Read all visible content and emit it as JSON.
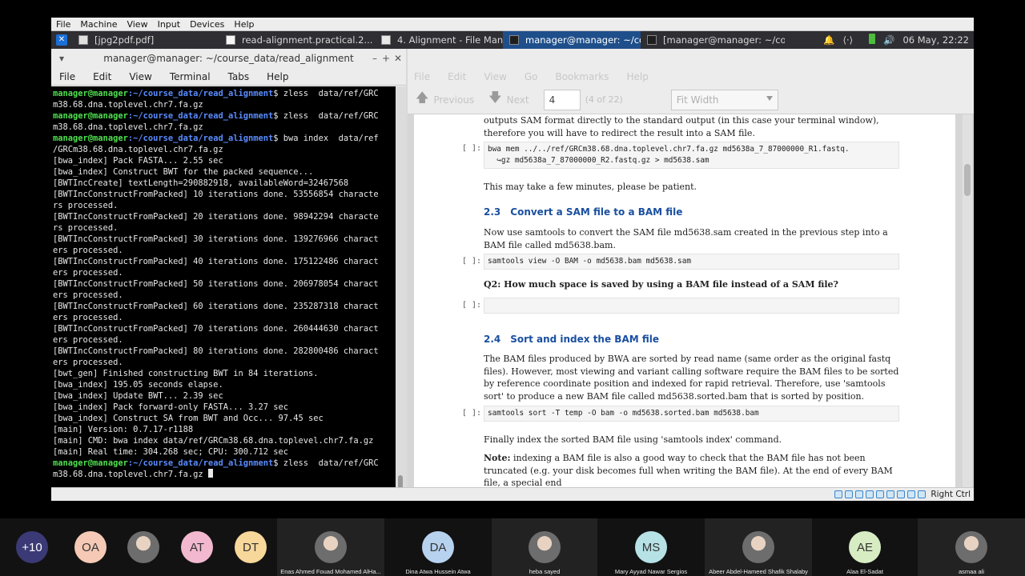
{
  "vbox_menu": [
    "File",
    "Machine",
    "View",
    "Input",
    "Devices",
    "Help"
  ],
  "panel": {
    "tasks": [
      {
        "label": "[jpg2pdf.pdf]",
        "active": false
      },
      {
        "label": "read-alignment.practical.2...",
        "active": false
      },
      {
        "label": "4. Alignment - File Manager",
        "active": false
      },
      {
        "label": "manager@manager: ~/cou...",
        "active": true
      },
      {
        "label": "[manager@manager: ~/co...",
        "active": false
      }
    ],
    "clock": "06 May, 22:22"
  },
  "terminal": {
    "title": "manager@manager: ~/course_data/read_alignment",
    "menu": [
      "File",
      "Edit",
      "View",
      "Terminal",
      "Tabs",
      "Help"
    ],
    "lines": [
      {
        "user": "manager@manager",
        "path": ":~/course_data/read_alignment",
        "text": "$ zless  data/ref/GRC"
      },
      {
        "text": "m38.68.dna.toplevel.chr7.fa.gz"
      },
      {
        "user": "manager@manager",
        "path": ":~/course_data/read_alignment",
        "text": "$ zless  data/ref/GRC"
      },
      {
        "text": "m38.68.dna.toplevel.chr7.fa.gz"
      },
      {
        "user": "manager@manager",
        "path": ":~/course_data/read_alignment",
        "text": "$ bwa index  data/ref"
      },
      {
        "text": "/GRCm38.68.dna.toplevel.chr7.fa.gz"
      },
      {
        "text": "[bwa_index] Pack FASTA... 2.55 sec"
      },
      {
        "text": "[bwa_index] Construct BWT for the packed sequence..."
      },
      {
        "text": "[BWTIncCreate] textLength=290882918, availableWord=32467568"
      },
      {
        "text": "[BWTIncConstructFromPacked] 10 iterations done. 53556854 characte"
      },
      {
        "text": "rs processed."
      },
      {
        "text": "[BWTIncConstructFromPacked] 20 iterations done. 98942294 characte"
      },
      {
        "text": "rs processed."
      },
      {
        "text": "[BWTIncConstructFromPacked] 30 iterations done. 139276966 charact"
      },
      {
        "text": "ers processed."
      },
      {
        "text": "[BWTIncConstructFromPacked] 40 iterations done. 175122486 charact"
      },
      {
        "text": "ers processed."
      },
      {
        "text": "[BWTIncConstructFromPacked] 50 iterations done. 206978054 charact"
      },
      {
        "text": "ers processed."
      },
      {
        "text": "[BWTIncConstructFromPacked] 60 iterations done. 235287318 charact"
      },
      {
        "text": "ers processed."
      },
      {
        "text": "[BWTIncConstructFromPacked] 70 iterations done. 260444630 charact"
      },
      {
        "text": "ers processed."
      },
      {
        "text": "[BWTIncConstructFromPacked] 80 iterations done. 282800486 charact"
      },
      {
        "text": "ers processed."
      },
      {
        "text": "[bwt_gen] Finished constructing BWT in 84 iterations."
      },
      {
        "text": "[bwa_index] 195.05 seconds elapse."
      },
      {
        "text": "[bwa_index] Update BWT... 2.39 sec"
      },
      {
        "text": "[bwa_index] Pack forward-only FASTA... 3.27 sec"
      },
      {
        "text": "[bwa_index] Construct SA from BWT and Occ... 97.45 sec"
      },
      {
        "text": "[main] Version: 0.7.17-r1188"
      },
      {
        "text": "[main] CMD: bwa index data/ref/GRCm38.68.dna.toplevel.chr7.fa.gz"
      },
      {
        "text": "[main] Real time: 304.268 sec; CPU: 300.712 sec"
      },
      {
        "user": "manager@manager",
        "path": ":~/course_data/read_alignment",
        "text": "$ zless  data/ref/GRC"
      },
      {
        "text": "m38.68.dna.toplevel.chr7.fa.gz ",
        "cursor": true
      }
    ]
  },
  "doc": {
    "menu": [
      "File",
      "Edit",
      "View",
      "Go",
      "Bookmarks",
      "Help"
    ],
    "toolbar": {
      "previous": "Previous",
      "next": "Next",
      "page": "4",
      "page_count": "(4 of 22)",
      "zoom": "Fit Width"
    },
    "intro": "outputs SAM format directly to the standard output (in this case your terminal window), therefore you will have to redirect the result into a SAM file.",
    "cell_label": "[ ]:",
    "code1": "bwa mem ../../ref/GRCm38.68.dna.toplevel.chr7.fa.gz md5638a_7_87000000_R1.fastq.\n  ↪gz md5638a_7_87000000_R2.fastq.gz > md5638.sam",
    "wait_text": "This may take a few minutes, please be patient.",
    "h23_num": "2.3",
    "h23_title": "Convert a SAM file to a BAM file",
    "p23": "Now use samtools to convert the SAM file md5638.sam created in the previous step into a BAM file called md5638.bam.",
    "code2": "samtools view -O BAM -o md5638.bam md5638.sam",
    "q2": "Q2:  How much space is saved by using a BAM file instead of a SAM file?",
    "h24_num": "2.4",
    "h24_title": "Sort and index the BAM file",
    "p24": "The BAM files produced by BWA are sorted by read name (same order as the original fastq files). However, most viewing and variant calling software require the BAM files to be sorted by reference coordinate position and indexed for rapid retrieval.  Therefore, use 'samtools sort' to produce a new BAM file called md5638.sorted.bam that is sorted by position.",
    "code3": "samtools sort -T temp -O bam -o md5638.sorted.bam md5638.bam",
    "p_index": "Finally index the sorted BAM file using 'samtools index' command.",
    "note_label": "Note:",
    "note_text": " indexing a BAM file is also a good way to check that the BAM file has not been truncated (e.g. your disk becomes full when writing the BAM file).  At the end of every BAM file, a special end"
  },
  "vbox_status": {
    "host_key": "Right Ctrl"
  },
  "participants": [
    {
      "initials": "+10",
      "name": "",
      "color": "#3b3a76"
    },
    {
      "initials": "OA",
      "name": "",
      "color": "#f5c9b6"
    },
    {
      "initials": "",
      "name": "",
      "color": "#555",
      "photo": true
    },
    {
      "initials": "AT",
      "name": "",
      "color": "#f2b8cf"
    },
    {
      "initials": "DT",
      "name": "",
      "color": "#f7d79a"
    },
    {
      "initials": "",
      "name": "Enas Ahmed Fouad Mohamed AlHa...",
      "photo": true
    },
    {
      "initials": "DA",
      "name": "Dina Atwa Hussein Atwa",
      "color": "#b7d2ef"
    },
    {
      "initials": "",
      "name": "heba sayed",
      "photo": true
    },
    {
      "initials": "MS",
      "name": "Mary Ayyad Nawar Sergios",
      "color": "#b6e2e6"
    },
    {
      "initials": "",
      "name": "Abeer Abdel-Hameed Shafik Shalaby",
      "photo": true
    },
    {
      "initials": "AE",
      "name": "Alaa El-Sadat",
      "color": "#d7ecc2"
    },
    {
      "initials": "",
      "name": "asmaa ali",
      "photo": true
    }
  ]
}
